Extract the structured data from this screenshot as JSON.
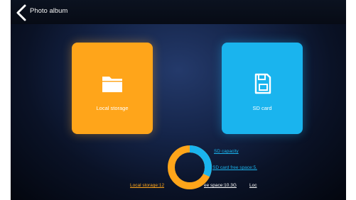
{
  "header": {
    "title": "Photo album"
  },
  "tiles": {
    "local": {
      "label": "Local storage",
      "color": "#ffa51a"
    },
    "sd": {
      "label": "SD card",
      "color": "#1ab4ee"
    }
  },
  "storage": {
    "sd_capacity": "SD capacity",
    "sd_free_space": "SD card free space:5.",
    "local_storage": "Local storage:12",
    "local_free_space": "ee space:10.3G",
    "local_free_suffix": "Loc",
    "sd_fraction": 0.32
  }
}
